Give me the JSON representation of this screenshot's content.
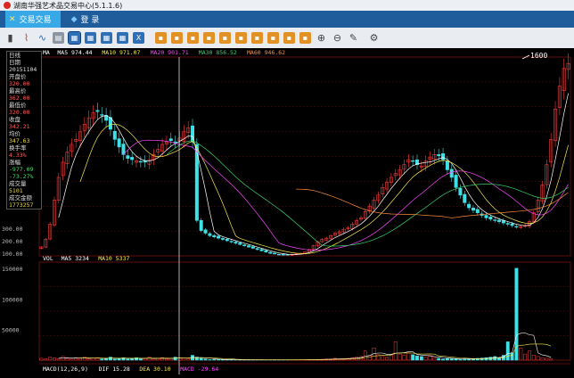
{
  "window": {
    "title": "湖南华强艺术品交易中心(5.1.1.6)"
  },
  "tabs": [
    {
      "label": "交易交易",
      "active": true
    },
    {
      "label": "登 录",
      "active": false
    }
  ],
  "toolbar_icons": [
    "bar-chart-icon",
    "candle-icon",
    "line-icon",
    "table-icon",
    "period-1-icon",
    "period-2-icon",
    "period-3-icon",
    "period-4-icon",
    "period-5-icon",
    "function-1-icon",
    "function-2-icon",
    "function-3-icon",
    "function-4-icon",
    "function-5-icon",
    "function-6-icon",
    "function-7-icon",
    "function-8-icon",
    "function-9-icon",
    "function-10-icon",
    "zoom-in-icon",
    "zoom-out-icon",
    "draw-icon",
    "settings-icon"
  ],
  "ma_legend": [
    {
      "label": "MA",
      "color": "#ffffff"
    },
    {
      "label": "MA5 974.44",
      "color": "#ffffff"
    },
    {
      "label": "MA10 971.07",
      "color": "#f6e94a"
    },
    {
      "label": "MA20 901.71",
      "color": "#ff44ff"
    },
    {
      "label": "MA30 856.52",
      "color": "#37d36a"
    },
    {
      "label": "MA60 946.62",
      "color": "#ff8c3c"
    }
  ],
  "price_axis": [
    "300.00",
    "200.00",
    "100.00"
  ],
  "peak_label": "1600",
  "info_panel": {
    "title": "日线",
    "date_label": "日期",
    "date": "20151104",
    "open_label": "开盘价",
    "open": "320.00",
    "high_label": "最高价",
    "high": "362.00",
    "low_label": "最低价",
    "low": "320.00",
    "close_label": "收盘",
    "close": "342.21",
    "avg_label": "均价",
    "avg": "347.63",
    "turnover_label": "换手率",
    "turnover": "4.33%",
    "change_label": "涨幅",
    "change": "-977.09",
    "change_pct": "-73.27%",
    "volume_label": "成交量",
    "volume": "5101",
    "amount_label": "成交金额",
    "amount": "1773257"
  },
  "vol_legend": [
    {
      "label": "VOL",
      "color": "#ffffff"
    },
    {
      "label": "MA5 3234",
      "color": "#ffffff"
    },
    {
      "label": "MA10 5337",
      "color": "#f6e94a"
    }
  ],
  "vol_axis": [
    "150000",
    "100000",
    "50000"
  ],
  "macd_legend": [
    {
      "label": "MACD(12,26,9)",
      "color": "#ffffff"
    },
    {
      "label": "DIF 15.28",
      "color": "#ffffff"
    },
    {
      "label": "DEA 30.10",
      "color": "#f6e94a"
    },
    {
      "label": "MACD -29.64",
      "color": "#ff44ff"
    }
  ],
  "chart_data": {
    "type": "candlestick",
    "y_range": [
      80,
      1650
    ],
    "closes": [
      150,
      210,
      330,
      520,
      700,
      820,
      900,
      960,
      1000,
      1060,
      1120,
      1170,
      1210,
      1220,
      1190,
      1150,
      1080,
      1000,
      940,
      880,
      850,
      840,
      830,
      820,
      820,
      840,
      880,
      920,
      960,
      980,
      990,
      980,
      1010,
      1060,
      1090,
      980,
      360,
      280,
      260,
      240,
      230,
      220,
      210,
      200,
      190,
      180,
      170,
      160,
      150,
      140,
      130,
      120,
      110,
      100,
      95,
      92,
      90,
      88,
      90,
      95,
      100,
      110,
      130,
      160,
      190,
      210,
      220,
      240,
      260,
      270,
      290,
      300,
      330,
      360,
      380,
      430,
      470,
      520,
      560,
      620,
      660,
      700,
      730,
      760,
      800,
      840,
      830,
      800,
      790,
      830,
      860,
      880,
      870,
      840,
      760,
      700,
      620,
      560,
      500,
      460,
      440,
      420,
      400,
      380,
      370,
      360,
      350,
      340,
      330,
      320,
      310,
      310,
      320,
      350,
      420,
      520,
      640,
      800,
      1000,
      1240,
      1420,
      1560,
      1600
    ],
    "volumes": [
      3000,
      2000,
      5000,
      4000,
      2000,
      6000,
      3000,
      2000,
      4000,
      3000,
      5000,
      2000,
      3000,
      4000,
      2000,
      3000,
      5000,
      2000,
      3000,
      4000,
      2000,
      3000,
      4000,
      2000,
      3000,
      5000,
      2000,
      3000,
      4000,
      2000,
      3000,
      5000,
      4000,
      3000,
      2000,
      8000,
      5000,
      3000,
      2000,
      1000,
      1200,
      900,
      800,
      700,
      600,
      500,
      400,
      500,
      600,
      500,
      400,
      300,
      400,
      500,
      600,
      500,
      400,
      300,
      400,
      500,
      600,
      700,
      800,
      900,
      1200,
      1500,
      1800,
      2000,
      3000,
      2000,
      2500,
      3000,
      4000,
      5000,
      6000,
      15000,
      8000,
      20000,
      9000,
      6000,
      5000,
      8000,
      30000,
      10000,
      8000,
      12000,
      9000,
      7000,
      6000,
      5000,
      8000,
      4000,
      3000,
      2000,
      2500,
      3000,
      2000,
      1500,
      1800,
      2000,
      2500,
      3000,
      3500,
      4000,
      5000,
      6000,
      4000,
      8000,
      30000,
      12000,
      150000,
      20000,
      10000,
      15000,
      8000,
      6000,
      4000,
      3000,
      2000
    ]
  }
}
